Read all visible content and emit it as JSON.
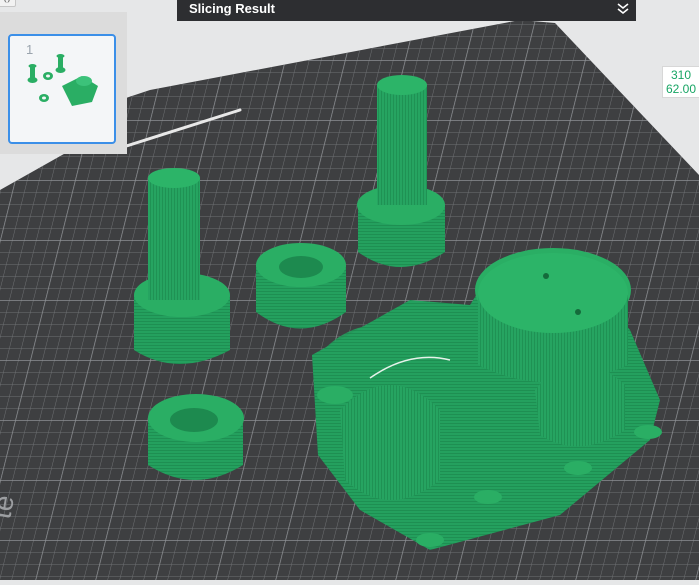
{
  "plates": {
    "active_index": "1"
  },
  "slicing_panel": {
    "title": "Slicing Result",
    "collapse_icon": "chevron-double-down-icon"
  },
  "collapse_toggle_icon": "angle-brackets-icon",
  "dimension_readout": {
    "line1": "310",
    "line2": "62.00"
  },
  "bed": {
    "brand_text": "te"
  },
  "colors": {
    "accent": "#3b8fe8",
    "model_green": "#23a05c",
    "bed": "#3e3f41",
    "background": "#e6e7e8",
    "panel": "#2d2e31",
    "readout": "#17a564"
  }
}
